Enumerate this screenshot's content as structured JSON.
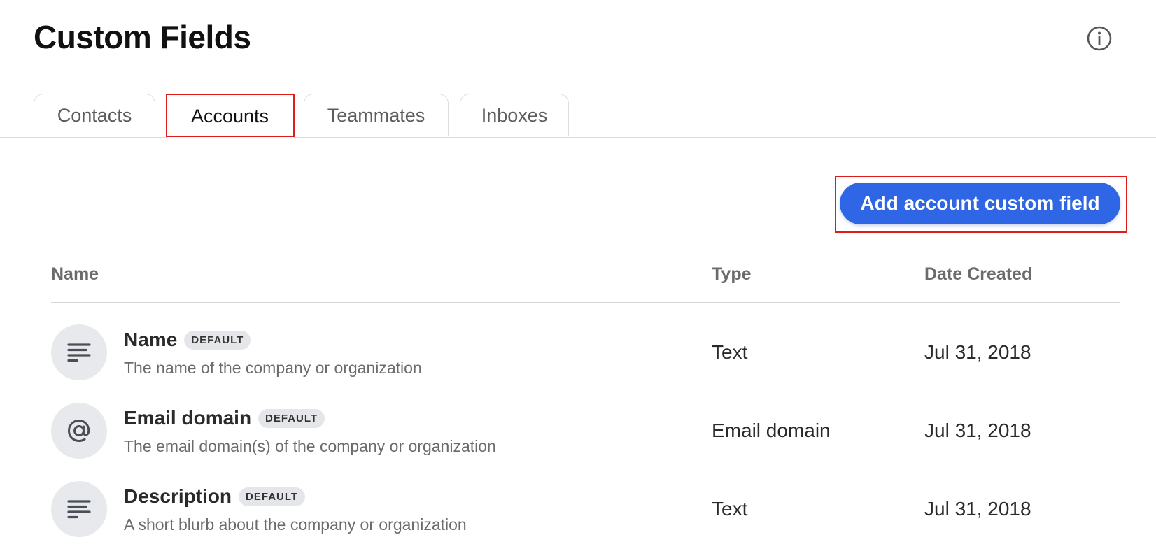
{
  "page": {
    "title": "Custom Fields"
  },
  "header": {
    "info_icon": "info-circle-icon"
  },
  "tabs": [
    {
      "label": "Contacts",
      "active": false
    },
    {
      "label": "Accounts",
      "active": true
    },
    {
      "label": "Teammates",
      "active": false
    },
    {
      "label": "Inboxes",
      "active": false
    }
  ],
  "toolbar": {
    "add_label": "Add account custom field"
  },
  "table": {
    "columns": [
      "Name",
      "Type",
      "Date Created"
    ],
    "rows": [
      {
        "icon": "text-lines-icon",
        "name": "Name",
        "badge": "DEFAULT",
        "description": "The name of the company or organization",
        "type": "Text",
        "date": "Jul 31, 2018"
      },
      {
        "icon": "at-sign-icon",
        "name": "Email domain",
        "badge": "DEFAULT",
        "description": "The email domain(s) of the company or organization",
        "type": "Email domain",
        "date": "Jul 31, 2018"
      },
      {
        "icon": "text-lines-icon",
        "name": "Description",
        "badge": "DEFAULT",
        "description": "A short blurb about the company or organization",
        "type": "Text",
        "date": "Jul 31, 2018"
      }
    ]
  },
  "colors": {
    "accent": "#2f66e6",
    "highlight": "#e01b1b",
    "icon_bg": "#e7e9ec"
  }
}
